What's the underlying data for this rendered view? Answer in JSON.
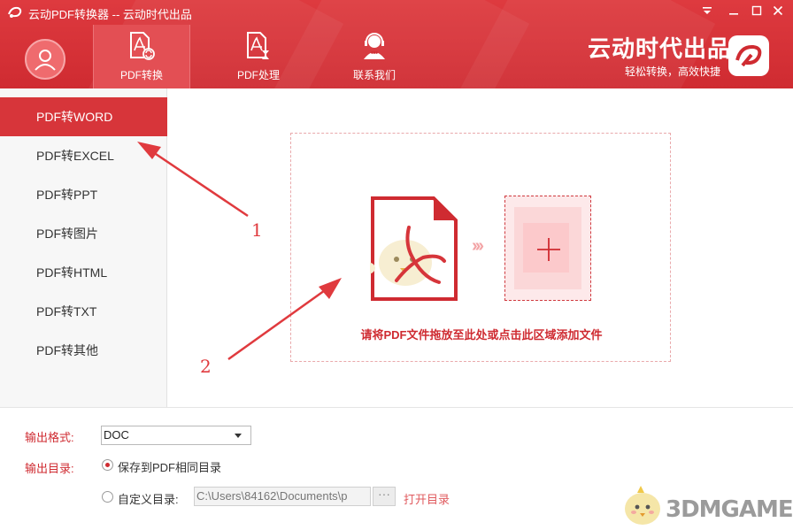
{
  "window": {
    "title": "云动PDF转换器 -- 云动时代出品"
  },
  "nav": {
    "tabs": [
      {
        "label": "PDF转换",
        "icon": "pdf-convert-icon"
      },
      {
        "label": "PDF处理",
        "icon": "pdf-process-icon"
      },
      {
        "label": "联系我们",
        "icon": "support-agent-icon"
      }
    ]
  },
  "brand": {
    "name": "云动时代出品",
    "slogan": "轻松转换，高效快捷"
  },
  "sidebar": {
    "items": [
      {
        "label": "PDF转WORD"
      },
      {
        "label": "PDF转EXCEL"
      },
      {
        "label": "PDF转PPT"
      },
      {
        "label": "PDF转图片"
      },
      {
        "label": "PDF转HTML"
      },
      {
        "label": "PDF转TXT"
      },
      {
        "label": "PDF转其他"
      }
    ]
  },
  "dropzone": {
    "text": "请将PDF文件拖放至此处或点击此区域添加文件",
    "arrows": "›››"
  },
  "annotations": {
    "one": "1",
    "two": "2"
  },
  "options": {
    "format_label": "输出格式:",
    "format_value": "DOC",
    "dir_label": "输出目录:",
    "same_dir_label": "保存到PDF相同目录",
    "custom_dir_label": "自定义目录:",
    "custom_dir_value": "C:\\Users\\84162\\Documents\\p",
    "browse_label": "···",
    "open_dir_label": "打开目录"
  },
  "watermark": {
    "text": "3DMGAME"
  },
  "colors": {
    "primary": "#cf2b31",
    "accent_light": "#fde9ea",
    "arrow_red": "#e03a3e"
  }
}
